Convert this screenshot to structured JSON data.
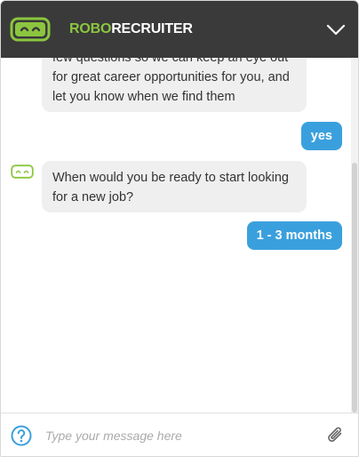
{
  "header": {
    "brand_part1": "ROBO",
    "brand_part2": "RECRUITER",
    "logo_icon": "robot-face-icon",
    "collapse_icon": "chevron-down-icon"
  },
  "messages": [
    {
      "sender": "bot",
      "text": "few questions so we can keep an eye out for great career opportunities for you, and let you know when we find them"
    },
    {
      "sender": "user",
      "text": "yes"
    },
    {
      "sender": "bot",
      "text": "When would you be ready to start looking for a new job?"
    },
    {
      "sender": "user",
      "text": "1 - 3 months"
    }
  ],
  "composer": {
    "placeholder": "Type your message here",
    "value": "",
    "help_icon": "question-circle-icon",
    "attach_icon": "paperclip-icon"
  },
  "colors": {
    "header_bg": "#3a3a3a",
    "brand_green": "#8cc63f",
    "user_bubble": "#3aa0dd",
    "bot_bubble": "#efefef"
  }
}
